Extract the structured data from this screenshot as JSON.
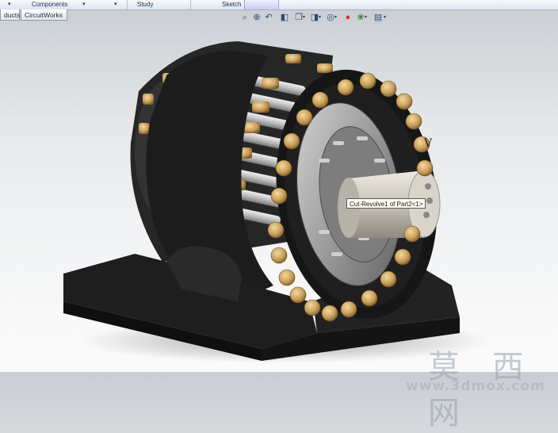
{
  "ribbon": {
    "components_label": "Components",
    "study_label": "Study",
    "sketch_label": "Sketch"
  },
  "tabs": [
    {
      "label": "ducts"
    },
    {
      "label": "CircuitWorks"
    }
  ],
  "view_toolbar": {
    "icons": [
      "zoom-to-fit-icon",
      "zoom-area-icon",
      "previous-view-icon",
      "section-view-icon",
      "view-orientation-icon",
      "display-style-icon",
      "hide-show-items-icon",
      "edit-appearance-icon",
      "apply-scene-icon",
      "view-settings-icon"
    ]
  },
  "viewport": {
    "tooltip": "Cut-Revolve1 of Part2<1>",
    "watermark_cjk": "莫 西 网",
    "watermark_url": "www.3dmox.com",
    "mark": "V"
  },
  "colors": {
    "frame": "#1c1c1c",
    "bolt": "#c99f5a",
    "disc": "#9a9a9a",
    "shaft": "#c8c3b8"
  }
}
